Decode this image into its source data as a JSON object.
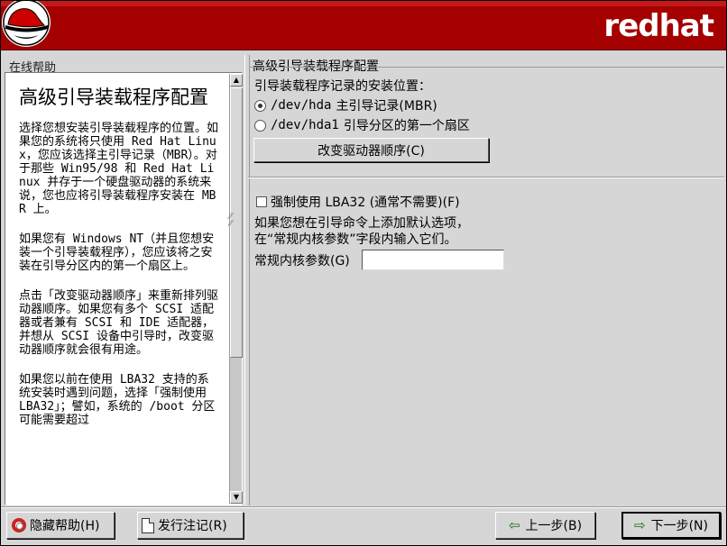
{
  "header": {
    "brand": "redhat",
    "logo_icon": "redhat-shadowman-icon"
  },
  "help": {
    "caption": "在线帮助",
    "title": "高级引导装载程序配置",
    "paragraphs": [
      "选择您想安装引导装载程序的位置。如果您的系统将只使用 Red Hat Linux，您应该选择主引导记录（MBR）。对于那些 Win95/98 和 Red Hat Linux 并存于一个硬盘驱动器的系统来说，您也应将引导装载程序安装在 MBR 上。",
      "如果您有 Windows NT（并且您想安装一个引导装载程序），您应该将之安装在引导分区内的第一个扇区上。",
      "点击「改变驱动器顺序」来重新排列驱动器顺序。如果您有多个 SCSI 适配器或者兼有 SCSI 和 IDE 适配器，并想从 SCSI 设备中引导时，改变驱动器顺序就会很有用途。",
      "如果您以前在使用 LBA32 支持的系统安装时遇到问题，选择「强制使用 LBA32」；譬如，系统的 /boot 分区可能需要超过"
    ]
  },
  "main": {
    "group_label": "高级引导装载程序配置",
    "location_question": "引导装载程序记录的安装位置：",
    "options": [
      {
        "device": "/dev/hda",
        "label": "主引导记录(MBR)",
        "selected": true
      },
      {
        "device": "/dev/hda1",
        "label": "引导分区的第一个扇区",
        "selected": false
      }
    ],
    "change_order_button": "改变驱动器顺序(C)",
    "force_lba32": {
      "label": "强制使用 LBA32 (通常不需要)(F)",
      "checked": false
    },
    "kernel_info_line1": "如果您想在引导命令上添加默认选项，",
    "kernel_info_line2": "在“常规内核参数”字段内输入它们。",
    "kernel_params_label": "常规内核参数(G)",
    "kernel_params_value": ""
  },
  "footer": {
    "hide_help": "隐藏帮助(H)",
    "release_notes": "发行注记(R)",
    "back": "上一步(B)",
    "next": "下一步(N)"
  },
  "colors": {
    "banner": "#a40000",
    "window_bg": "#d6d6d6"
  }
}
